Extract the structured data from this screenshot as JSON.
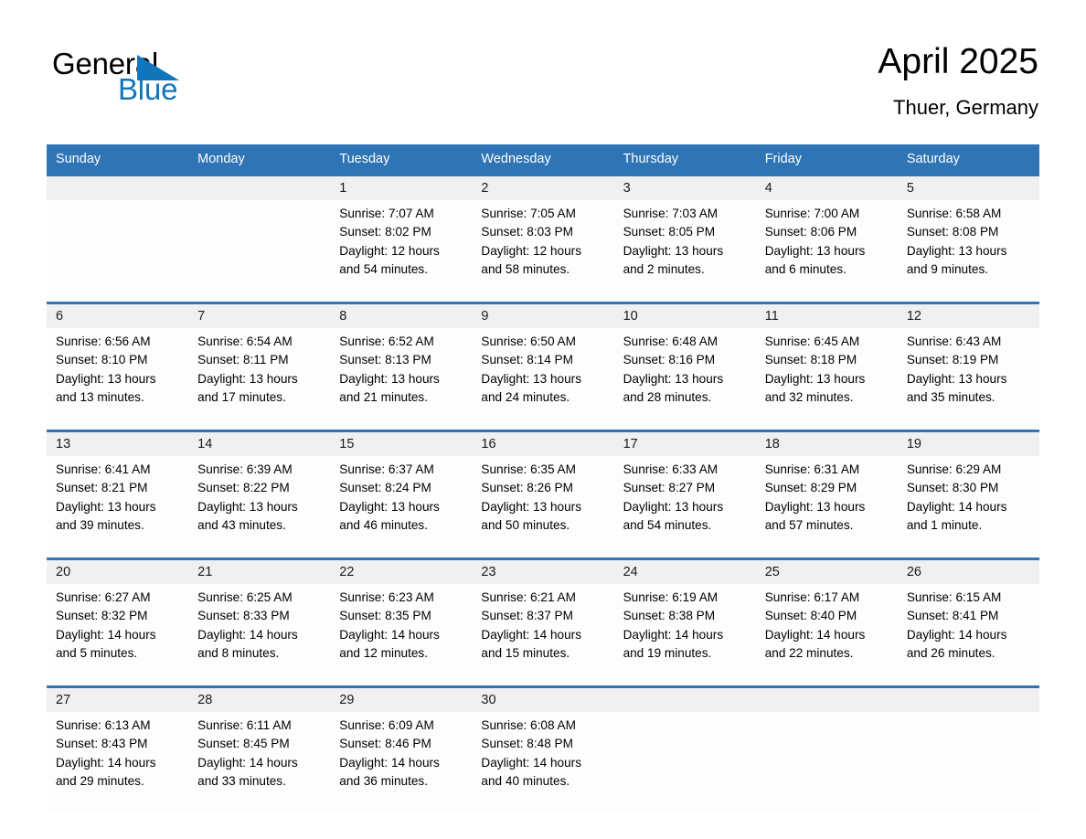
{
  "brand": {
    "name_dark": "General",
    "name_light": "Blue",
    "triangle_icon": "triangle-icon",
    "accent_color": "#1275bc"
  },
  "header": {
    "title": "April 2025",
    "subtitle": "Thuer, Germany",
    "header_bg_color": "#2f74b5",
    "daynum_bg_color": "#f0f0f0"
  },
  "weekday_headers": [
    "Sunday",
    "Monday",
    "Tuesday",
    "Wednesday",
    "Thursday",
    "Friday",
    "Saturday"
  ],
  "weeks": [
    [
      {
        "day": "",
        "sunrise": "",
        "sunset": "",
        "daylight_line1": "",
        "daylight_line2": ""
      },
      {
        "day": "",
        "sunrise": "",
        "sunset": "",
        "daylight_line1": "",
        "daylight_line2": ""
      },
      {
        "day": "1",
        "sunrise": "Sunrise: 7:07 AM",
        "sunset": "Sunset: 8:02 PM",
        "daylight_line1": "Daylight: 12 hours",
        "daylight_line2": "and 54 minutes."
      },
      {
        "day": "2",
        "sunrise": "Sunrise: 7:05 AM",
        "sunset": "Sunset: 8:03 PM",
        "daylight_line1": "Daylight: 12 hours",
        "daylight_line2": "and 58 minutes."
      },
      {
        "day": "3",
        "sunrise": "Sunrise: 7:03 AM",
        "sunset": "Sunset: 8:05 PM",
        "daylight_line1": "Daylight: 13 hours",
        "daylight_line2": "and 2 minutes."
      },
      {
        "day": "4",
        "sunrise": "Sunrise: 7:00 AM",
        "sunset": "Sunset: 8:06 PM",
        "daylight_line1": "Daylight: 13 hours",
        "daylight_line2": "and 6 minutes."
      },
      {
        "day": "5",
        "sunrise": "Sunrise: 6:58 AM",
        "sunset": "Sunset: 8:08 PM",
        "daylight_line1": "Daylight: 13 hours",
        "daylight_line2": "and 9 minutes."
      }
    ],
    [
      {
        "day": "6",
        "sunrise": "Sunrise: 6:56 AM",
        "sunset": "Sunset: 8:10 PM",
        "daylight_line1": "Daylight: 13 hours",
        "daylight_line2": "and 13 minutes."
      },
      {
        "day": "7",
        "sunrise": "Sunrise: 6:54 AM",
        "sunset": "Sunset: 8:11 PM",
        "daylight_line1": "Daylight: 13 hours",
        "daylight_line2": "and 17 minutes."
      },
      {
        "day": "8",
        "sunrise": "Sunrise: 6:52 AM",
        "sunset": "Sunset: 8:13 PM",
        "daylight_line1": "Daylight: 13 hours",
        "daylight_line2": "and 21 minutes."
      },
      {
        "day": "9",
        "sunrise": "Sunrise: 6:50 AM",
        "sunset": "Sunset: 8:14 PM",
        "daylight_line1": "Daylight: 13 hours",
        "daylight_line2": "and 24 minutes."
      },
      {
        "day": "10",
        "sunrise": "Sunrise: 6:48 AM",
        "sunset": "Sunset: 8:16 PM",
        "daylight_line1": "Daylight: 13 hours",
        "daylight_line2": "and 28 minutes."
      },
      {
        "day": "11",
        "sunrise": "Sunrise: 6:45 AM",
        "sunset": "Sunset: 8:18 PM",
        "daylight_line1": "Daylight: 13 hours",
        "daylight_line2": "and 32 minutes."
      },
      {
        "day": "12",
        "sunrise": "Sunrise: 6:43 AM",
        "sunset": "Sunset: 8:19 PM",
        "daylight_line1": "Daylight: 13 hours",
        "daylight_line2": "and 35 minutes."
      }
    ],
    [
      {
        "day": "13",
        "sunrise": "Sunrise: 6:41 AM",
        "sunset": "Sunset: 8:21 PM",
        "daylight_line1": "Daylight: 13 hours",
        "daylight_line2": "and 39 minutes."
      },
      {
        "day": "14",
        "sunrise": "Sunrise: 6:39 AM",
        "sunset": "Sunset: 8:22 PM",
        "daylight_line1": "Daylight: 13 hours",
        "daylight_line2": "and 43 minutes."
      },
      {
        "day": "15",
        "sunrise": "Sunrise: 6:37 AM",
        "sunset": "Sunset: 8:24 PM",
        "daylight_line1": "Daylight: 13 hours",
        "daylight_line2": "and 46 minutes."
      },
      {
        "day": "16",
        "sunrise": "Sunrise: 6:35 AM",
        "sunset": "Sunset: 8:26 PM",
        "daylight_line1": "Daylight: 13 hours",
        "daylight_line2": "and 50 minutes."
      },
      {
        "day": "17",
        "sunrise": "Sunrise: 6:33 AM",
        "sunset": "Sunset: 8:27 PM",
        "daylight_line1": "Daylight: 13 hours",
        "daylight_line2": "and 54 minutes."
      },
      {
        "day": "18",
        "sunrise": "Sunrise: 6:31 AM",
        "sunset": "Sunset: 8:29 PM",
        "daylight_line1": "Daylight: 13 hours",
        "daylight_line2": "and 57 minutes."
      },
      {
        "day": "19",
        "sunrise": "Sunrise: 6:29 AM",
        "sunset": "Sunset: 8:30 PM",
        "daylight_line1": "Daylight: 14 hours",
        "daylight_line2": "and 1 minute."
      }
    ],
    [
      {
        "day": "20",
        "sunrise": "Sunrise: 6:27 AM",
        "sunset": "Sunset: 8:32 PM",
        "daylight_line1": "Daylight: 14 hours",
        "daylight_line2": "and 5 minutes."
      },
      {
        "day": "21",
        "sunrise": "Sunrise: 6:25 AM",
        "sunset": "Sunset: 8:33 PM",
        "daylight_line1": "Daylight: 14 hours",
        "daylight_line2": "and 8 minutes."
      },
      {
        "day": "22",
        "sunrise": "Sunrise: 6:23 AM",
        "sunset": "Sunset: 8:35 PM",
        "daylight_line1": "Daylight: 14 hours",
        "daylight_line2": "and 12 minutes."
      },
      {
        "day": "23",
        "sunrise": "Sunrise: 6:21 AM",
        "sunset": "Sunset: 8:37 PM",
        "daylight_line1": "Daylight: 14 hours",
        "daylight_line2": "and 15 minutes."
      },
      {
        "day": "24",
        "sunrise": "Sunrise: 6:19 AM",
        "sunset": "Sunset: 8:38 PM",
        "daylight_line1": "Daylight: 14 hours",
        "daylight_line2": "and 19 minutes."
      },
      {
        "day": "25",
        "sunrise": "Sunrise: 6:17 AM",
        "sunset": "Sunset: 8:40 PM",
        "daylight_line1": "Daylight: 14 hours",
        "daylight_line2": "and 22 minutes."
      },
      {
        "day": "26",
        "sunrise": "Sunrise: 6:15 AM",
        "sunset": "Sunset: 8:41 PM",
        "daylight_line1": "Daylight: 14 hours",
        "daylight_line2": "and 26 minutes."
      }
    ],
    [
      {
        "day": "27",
        "sunrise": "Sunrise: 6:13 AM",
        "sunset": "Sunset: 8:43 PM",
        "daylight_line1": "Daylight: 14 hours",
        "daylight_line2": "and 29 minutes."
      },
      {
        "day": "28",
        "sunrise": "Sunrise: 6:11 AM",
        "sunset": "Sunset: 8:45 PM",
        "daylight_line1": "Daylight: 14 hours",
        "daylight_line2": "and 33 minutes."
      },
      {
        "day": "29",
        "sunrise": "Sunrise: 6:09 AM",
        "sunset": "Sunset: 8:46 PM",
        "daylight_line1": "Daylight: 14 hours",
        "daylight_line2": "and 36 minutes."
      },
      {
        "day": "30",
        "sunrise": "Sunrise: 6:08 AM",
        "sunset": "Sunset: 8:48 PM",
        "daylight_line1": "Daylight: 14 hours",
        "daylight_line2": "and 40 minutes."
      },
      {
        "day": "",
        "sunrise": "",
        "sunset": "",
        "daylight_line1": "",
        "daylight_line2": ""
      },
      {
        "day": "",
        "sunrise": "",
        "sunset": "",
        "daylight_line1": "",
        "daylight_line2": ""
      },
      {
        "day": "",
        "sunrise": "",
        "sunset": "",
        "daylight_line1": "",
        "daylight_line2": ""
      }
    ]
  ]
}
